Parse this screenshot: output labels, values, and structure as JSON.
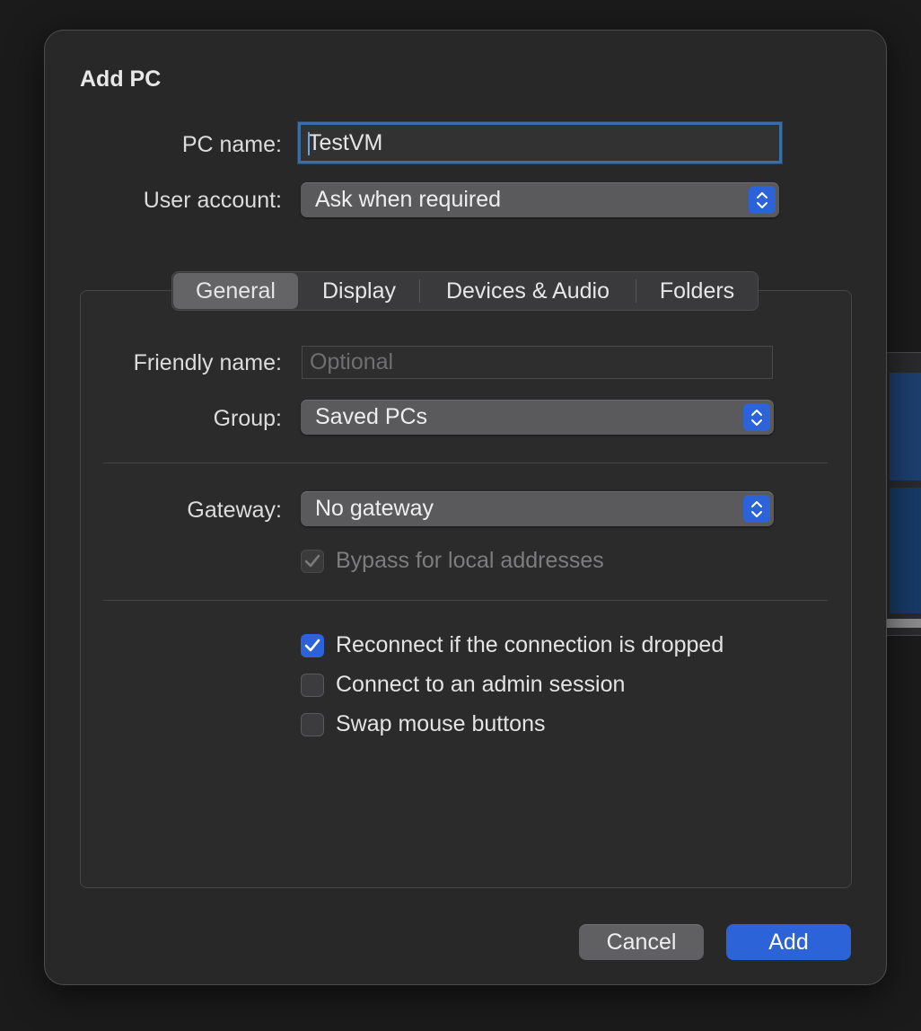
{
  "dialog": {
    "title": "Add PC",
    "pc_name": {
      "label": "PC name:",
      "value": "TestVM"
    },
    "user_account": {
      "label": "User account:",
      "value": "Ask when required"
    },
    "tabs": [
      {
        "label": "General",
        "selected": true
      },
      {
        "label": "Display",
        "selected": false
      },
      {
        "label": "Devices & Audio",
        "selected": false
      },
      {
        "label": "Folders",
        "selected": false
      }
    ],
    "general": {
      "friendly_name": {
        "label": "Friendly name:",
        "placeholder": "Optional",
        "value": ""
      },
      "group": {
        "label": "Group:",
        "value": "Saved PCs"
      },
      "gateway": {
        "label": "Gateway:",
        "value": "No gateway"
      },
      "bypass_local": {
        "label": "Bypass for local addresses",
        "checked": true,
        "enabled": false
      },
      "reconnect": {
        "label": "Reconnect if the connection is dropped",
        "checked": true
      },
      "admin_session": {
        "label": "Connect to an admin session",
        "checked": false
      },
      "swap_mouse": {
        "label": "Swap mouse buttons",
        "checked": false
      }
    },
    "buttons": {
      "cancel": "Cancel",
      "add": "Add"
    }
  },
  "colors": {
    "accent": "#2d63d8",
    "background": "#1b1b1c",
    "dialog": "#282829"
  }
}
